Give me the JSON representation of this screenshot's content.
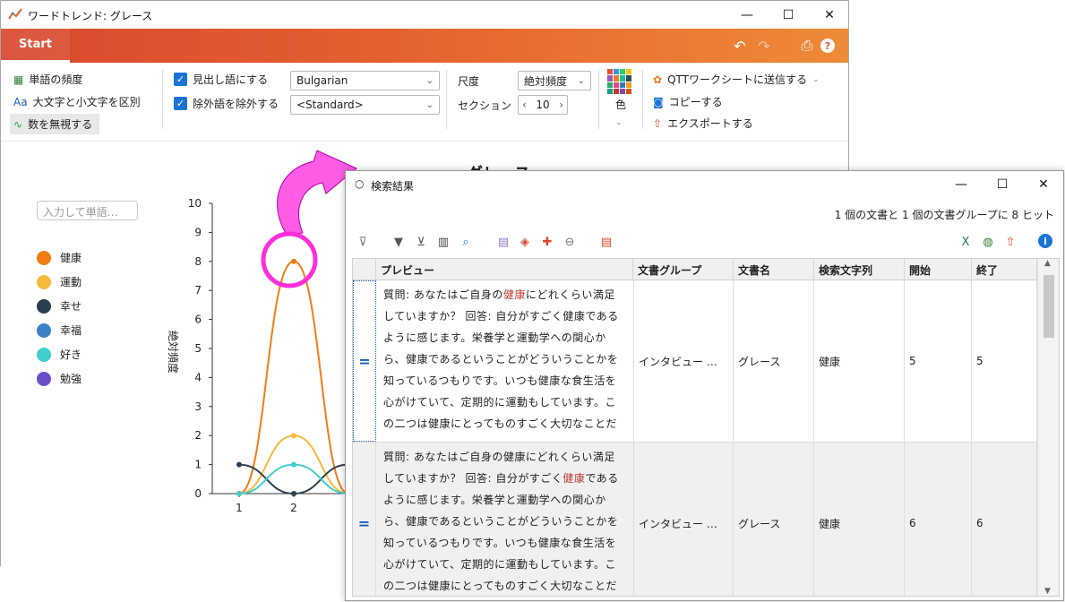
{
  "main_window": {
    "title": "ワードトレンド: グレース",
    "tab": "Start",
    "options": {
      "word_freq": "単語の頻度",
      "case_sensitive": "大文字と小文字を区別",
      "ignore_numbers": "数を無視する",
      "headword": "見出し語にする",
      "stopwords": "除外語を除外する",
      "language": "Bulgarian",
      "stoplist": "<Standard>",
      "scale_label": "尺度",
      "scale_value": "絶対頻度",
      "section_label": "セクション",
      "section_value": "10",
      "color_label": "色",
      "send_qtt": "QTTワークシートに送信する",
      "copy": "コピーする",
      "export": "エクスポートする"
    },
    "search_placeholder": "入力して単語…",
    "chart_title": "グレース"
  },
  "legend": [
    {
      "name": "健康",
      "color": "#f27d13"
    },
    {
      "name": "運動",
      "color": "#f6b93b"
    },
    {
      "name": "幸せ",
      "color": "#2c3e50"
    },
    {
      "name": "幸福",
      "color": "#3b82c4"
    },
    {
      "name": "好き",
      "color": "#3ecfcf"
    },
    {
      "name": "勉強",
      "color": "#6a4fc8"
    }
  ],
  "chart_data": {
    "type": "line",
    "ylabel": "絶対頻度",
    "ylim": [
      0,
      10
    ],
    "yticks": [
      "0",
      "1",
      "2",
      "3",
      "4",
      "5",
      "6",
      "7",
      "8",
      "9",
      "10"
    ],
    "x": [
      1,
      2,
      3
    ],
    "xticks": [
      "1",
      "2"
    ],
    "series": [
      {
        "name": "健康",
        "values": [
          0,
          8,
          0
        ]
      },
      {
        "name": "運動",
        "values": [
          0,
          2,
          0
        ]
      },
      {
        "name": "幸せ",
        "values": [
          1,
          0,
          1
        ]
      },
      {
        "name": "好き",
        "values": [
          0,
          1,
          0
        ]
      }
    ]
  },
  "search_window": {
    "title": "検索結果",
    "hits": "1 個の文書と 1 個の文書グループに 8 ヒット",
    "columns": [
      "プレビュー",
      "文書グループ",
      "文書名",
      "検索文字列",
      "開始",
      "終了"
    ],
    "rows": [
      {
        "preview_before": "質問: あなたはご自身の",
        "preview_kw": "健康",
        "preview_after": "にどれくらい満足していますか？ 回答: 自分がすごく健康であるように感じます。栄養学と運動学への関心から、健康であるということがどういうことかを知っているつもりです。いつも健康な食生活を心がけていて、定期的に運動もしています。この二つは健康にとってものすごく大切なことだ",
        "group": "インタビュー …",
        "doc": "グレース",
        "term": "健康",
        "start": "5",
        "end": "5"
      },
      {
        "preview_before": "質問: あなたはご自身の健康にどれくらい満足していますか？ 回答: 自分がすごく",
        "preview_kw": "健康",
        "preview_after": "であるように感じます。栄養学と運動学への関心から、健康であるということがどういうことかを知っているつもりです。いつも健康な食生活を心がけていて、定期的に運動もしています。この二つは健康にとってものすごく大切なことだ",
        "group": "インタビュー …",
        "doc": "グレース",
        "term": "健康",
        "start": "6",
        "end": "6"
      }
    ]
  }
}
